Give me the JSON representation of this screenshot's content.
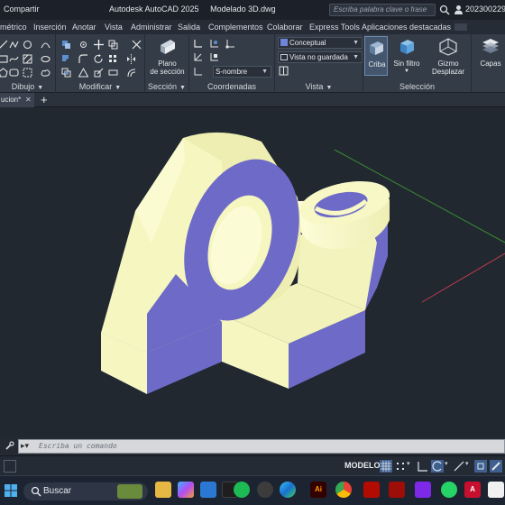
{
  "titlebar": {
    "share_label": "Compartir",
    "app_name": "Autodesk AutoCAD 2025",
    "file_name": "Modelado 3D.dwg",
    "search_placeholder": "Escriba palabra clave o frase",
    "user_name": "202300229"
  },
  "menu": {
    "tabs": [
      "métrico",
      "Inserción",
      "Anotar",
      "Vista",
      "Administrar",
      "Salida",
      "Complementos",
      "Colaborar",
      "Express Tools",
      "Aplicaciones destacadas"
    ]
  },
  "ribbon": {
    "groups": {
      "dibujo": "Dibujo",
      "modificar": "Modificar",
      "seccion": "Sección",
      "coordenadas": "Coordenadas",
      "vista": "Vista",
      "seleccion": "Selección"
    },
    "plano_label_1": "Plano",
    "plano_label_2": "de sección",
    "visual_style": "Conceptual",
    "saved_view": "Vista no guardada",
    "ucs_name": "S-nombre",
    "criba_label": "Criba",
    "sin_filtro_label": "Sin filtro",
    "gizmo_label_1": "Gizmo",
    "gizmo_label_2": "Desplazar",
    "capas_label": "Capas"
  },
  "document_tabs": {
    "active_tab": "ucion*",
    "add_symbol": "+"
  },
  "command_line": {
    "placeholder": "Escriba un comando"
  },
  "status_bar": {
    "space_label": "MODELO"
  },
  "taskbar": {
    "search_label": "Buscar",
    "apps": [
      "explorer-icon",
      "copilot-icon",
      "dev-icon",
      "spotify-icon",
      "edge-icon",
      "store-icon",
      "illustrator-icon",
      "chrome-icon",
      "acrobat-icon",
      "photoshop-icon",
      "autocad-icon"
    ]
  },
  "colors": {
    "model_face_light": "#f6f6c1",
    "model_face_dark": "#6d6bc7",
    "axis_green": "#3b8c35",
    "axis_red": "#c23c4f",
    "viewport_bg": "#212830"
  }
}
